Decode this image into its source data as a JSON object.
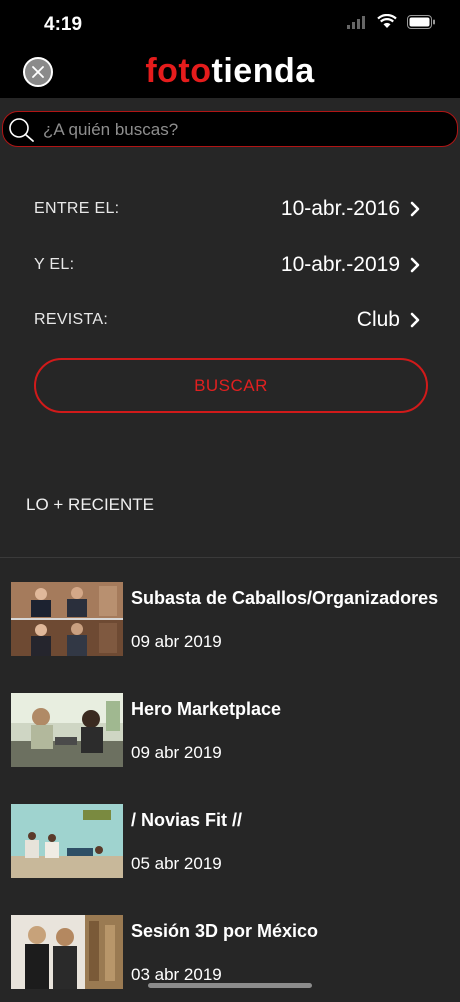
{
  "status": {
    "time": "4:19"
  },
  "header": {
    "logo_part1": "foto",
    "logo_part2": "tienda"
  },
  "search": {
    "placeholder": "¿A quién buscas?",
    "value": ""
  },
  "filters": [
    {
      "label": "ENTRE EL:",
      "value": "10-abr.-2016"
    },
    {
      "label": "Y EL:",
      "value": "10-abr.-2019"
    },
    {
      "label": "REVISTA:",
      "value": "Club"
    }
  ],
  "search_button": {
    "label": "BUSCAR"
  },
  "recent": {
    "title": "LO + RECIENTE",
    "items": [
      {
        "title": "Subasta de Caballos/Organizadores",
        "date": "09 abr 2019"
      },
      {
        "title": "Hero Marketplace",
        "date": "09 abr 2019"
      },
      {
        "title": "/ Novias Fit //",
        "date": "05 abr 2019"
      },
      {
        "title": "Sesión 3D por México",
        "date": "03 abr 2019"
      }
    ]
  },
  "colors": {
    "accent": "#e51c1c",
    "background": "#262626",
    "bar": "#000000"
  }
}
